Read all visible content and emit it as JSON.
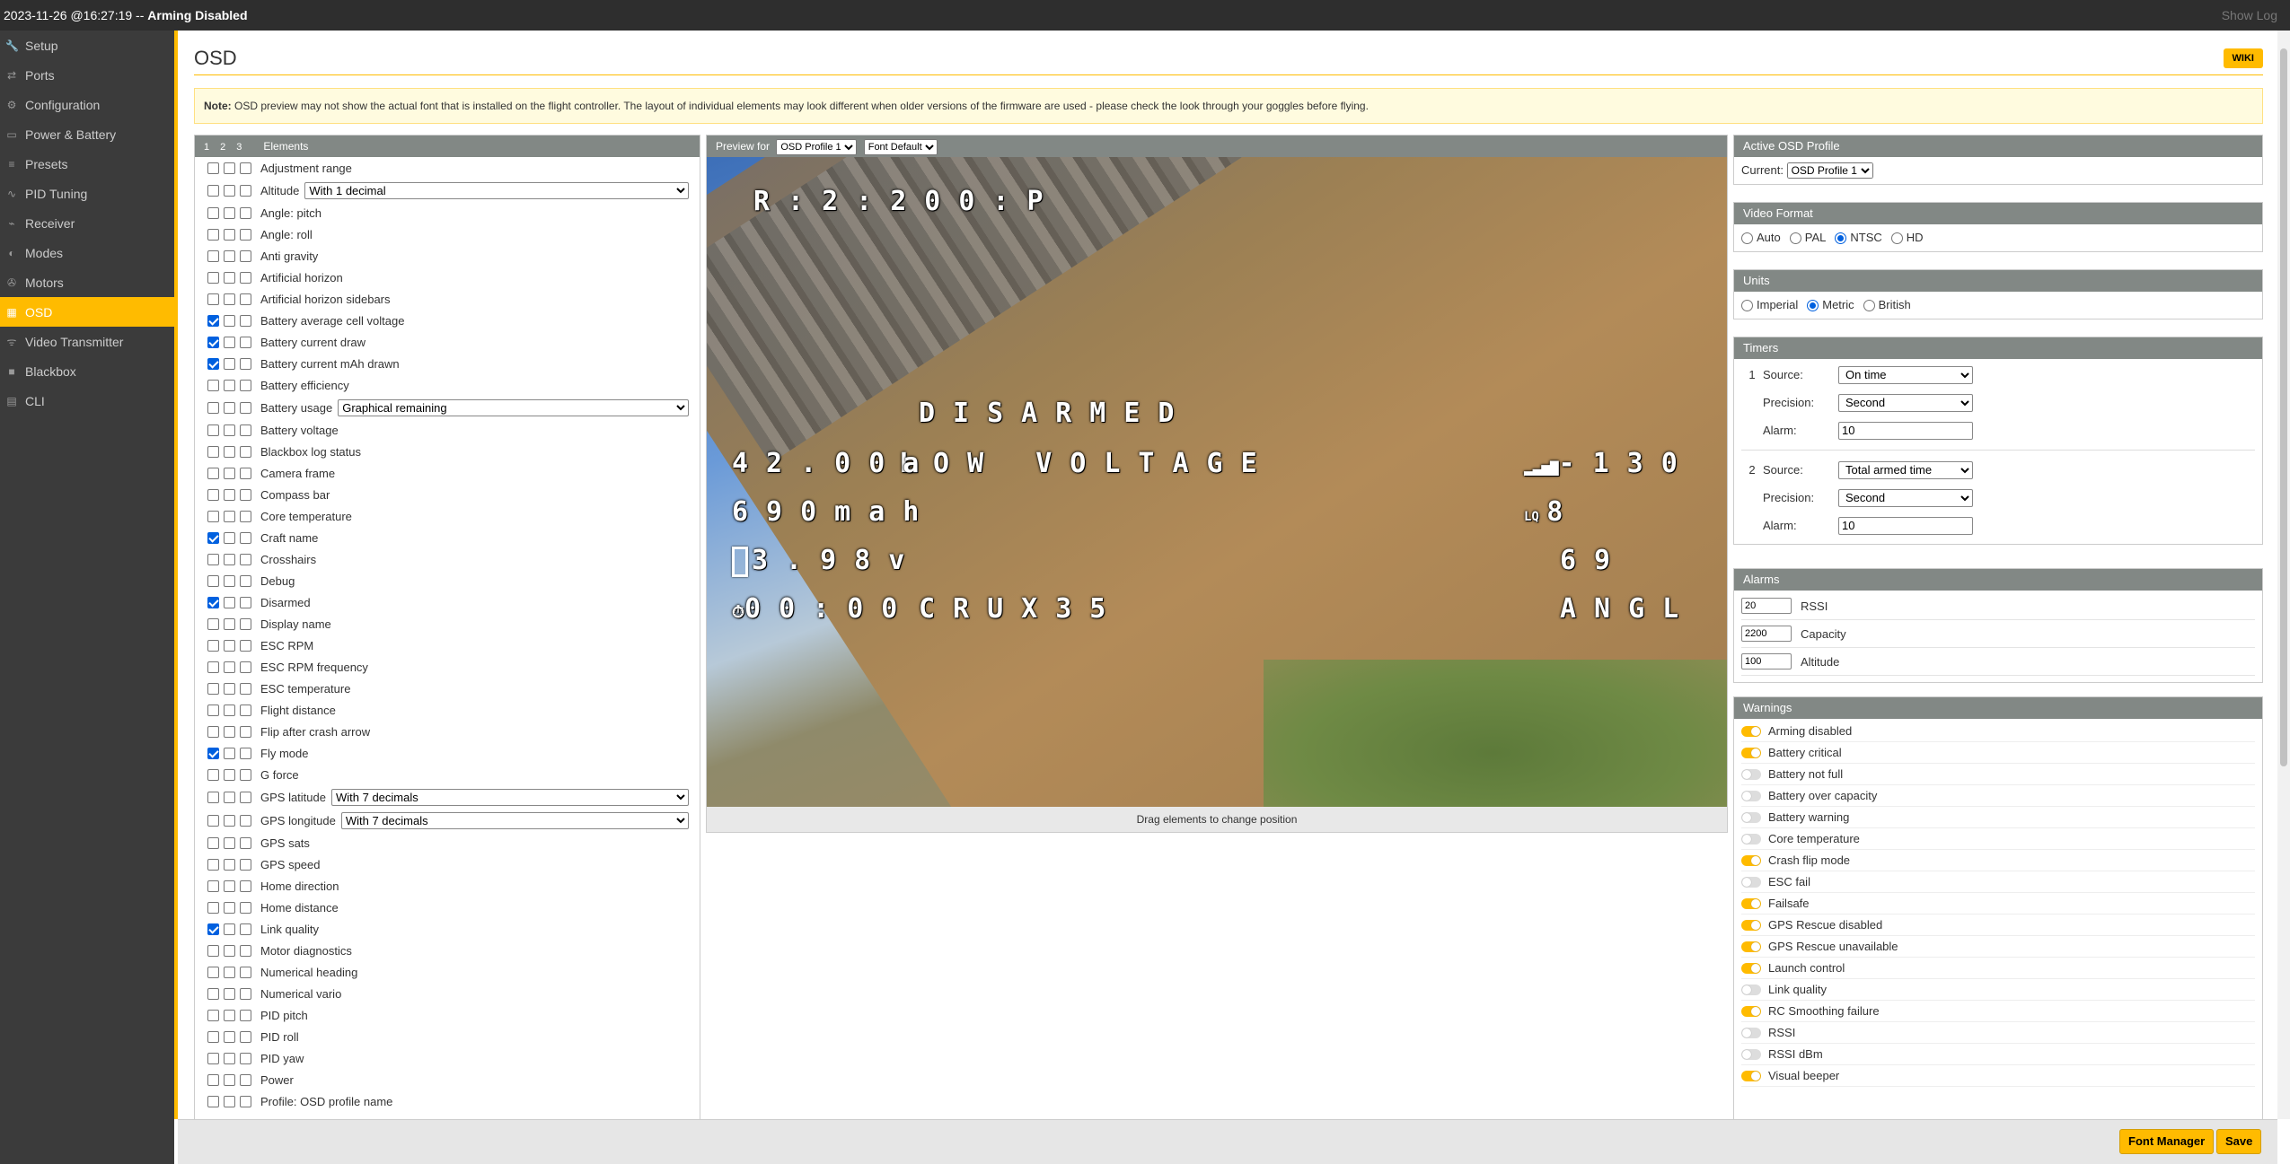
{
  "topbar": {
    "status_prefix": "2023-11-26 @16:27:19 -- ",
    "status_state": "Arming Disabled",
    "show_log": "Show Log"
  },
  "sidebar": {
    "items": [
      {
        "label": "Setup",
        "icon": "wrench-icon"
      },
      {
        "label": "Ports",
        "icon": "plug-icon"
      },
      {
        "label": "Configuration",
        "icon": "gears-icon"
      },
      {
        "label": "Power & Battery",
        "icon": "battery-icon"
      },
      {
        "label": "Presets",
        "icon": "sliders-icon"
      },
      {
        "label": "PID Tuning",
        "icon": "tuning-icon"
      },
      {
        "label": "Receiver",
        "icon": "receiver-icon"
      },
      {
        "label": "Modes",
        "icon": "modes-icon"
      },
      {
        "label": "Motors",
        "icon": "motor-icon"
      },
      {
        "label": "OSD",
        "icon": "osd-icon"
      },
      {
        "label": "Video Transmitter",
        "icon": "antenna-icon"
      },
      {
        "label": "Blackbox",
        "icon": "blackbox-icon"
      },
      {
        "label": "CLI",
        "icon": "terminal-icon"
      }
    ],
    "active_index": 9
  },
  "page": {
    "title": "OSD",
    "wiki": "WIKI",
    "note_bold": "Note:",
    "note_text": " OSD preview may not show the actual font that is installed on the flight controller. The layout of individual elements may look different when older versions of the firmware are used - please check the look through your goggles before flying."
  },
  "elements_panel": {
    "tabs": [
      "1",
      "2",
      "3"
    ],
    "title": "Elements",
    "items": [
      {
        "name": "Adjustment range",
        "checked": [
          false,
          false,
          false
        ]
      },
      {
        "name": "Altitude",
        "checked": [
          false,
          false,
          false
        ],
        "select": "With 1 decimal"
      },
      {
        "name": "Angle: pitch",
        "checked": [
          false,
          false,
          false
        ]
      },
      {
        "name": "Angle: roll",
        "checked": [
          false,
          false,
          false
        ]
      },
      {
        "name": "Anti gravity",
        "checked": [
          false,
          false,
          false
        ]
      },
      {
        "name": "Artificial horizon",
        "checked": [
          false,
          false,
          false
        ]
      },
      {
        "name": "Artificial horizon sidebars",
        "checked": [
          false,
          false,
          false
        ]
      },
      {
        "name": "Battery average cell voltage",
        "checked": [
          true,
          false,
          false
        ]
      },
      {
        "name": "Battery current draw",
        "checked": [
          true,
          false,
          false
        ]
      },
      {
        "name": "Battery current mAh drawn",
        "checked": [
          true,
          false,
          false
        ]
      },
      {
        "name": "Battery efficiency",
        "checked": [
          false,
          false,
          false
        ]
      },
      {
        "name": "Battery usage",
        "checked": [
          false,
          false,
          false
        ],
        "select": "Graphical remaining"
      },
      {
        "name": "Battery voltage",
        "checked": [
          false,
          false,
          false
        ]
      },
      {
        "name": "Blackbox log status",
        "checked": [
          false,
          false,
          false
        ]
      },
      {
        "name": "Camera frame",
        "checked": [
          false,
          false,
          false
        ]
      },
      {
        "name": "Compass bar",
        "checked": [
          false,
          false,
          false
        ]
      },
      {
        "name": "Core temperature",
        "checked": [
          false,
          false,
          false
        ]
      },
      {
        "name": "Craft name",
        "checked": [
          true,
          false,
          false
        ]
      },
      {
        "name": "Crosshairs",
        "checked": [
          false,
          false,
          false
        ]
      },
      {
        "name": "Debug",
        "checked": [
          false,
          false,
          false
        ]
      },
      {
        "name": "Disarmed",
        "checked": [
          true,
          false,
          false
        ]
      },
      {
        "name": "Display name",
        "checked": [
          false,
          false,
          false
        ]
      },
      {
        "name": "ESC RPM",
        "checked": [
          false,
          false,
          false
        ]
      },
      {
        "name": "ESC RPM frequency",
        "checked": [
          false,
          false,
          false
        ]
      },
      {
        "name": "ESC temperature",
        "checked": [
          false,
          false,
          false
        ]
      },
      {
        "name": "Flight distance",
        "checked": [
          false,
          false,
          false
        ]
      },
      {
        "name": "Flip after crash arrow",
        "checked": [
          false,
          false,
          false
        ]
      },
      {
        "name": "Fly mode",
        "checked": [
          true,
          false,
          false
        ]
      },
      {
        "name": "G force",
        "checked": [
          false,
          false,
          false
        ]
      },
      {
        "name": "GPS latitude",
        "checked": [
          false,
          false,
          false
        ],
        "select": "With 7 decimals"
      },
      {
        "name": "GPS longitude",
        "checked": [
          false,
          false,
          false
        ],
        "select": "With 7 decimals"
      },
      {
        "name": "GPS sats",
        "checked": [
          false,
          false,
          false
        ]
      },
      {
        "name": "GPS speed",
        "checked": [
          false,
          false,
          false
        ]
      },
      {
        "name": "Home direction",
        "checked": [
          false,
          false,
          false
        ]
      },
      {
        "name": "Home distance",
        "checked": [
          false,
          false,
          false
        ]
      },
      {
        "name": "Link quality",
        "checked": [
          true,
          false,
          false
        ]
      },
      {
        "name": "Motor diagnostics",
        "checked": [
          false,
          false,
          false
        ]
      },
      {
        "name": "Numerical heading",
        "checked": [
          false,
          false,
          false
        ]
      },
      {
        "name": "Numerical vario",
        "checked": [
          false,
          false,
          false
        ]
      },
      {
        "name": "PID pitch",
        "checked": [
          false,
          false,
          false
        ]
      },
      {
        "name": "PID roll",
        "checked": [
          false,
          false,
          false
        ]
      },
      {
        "name": "PID yaw",
        "checked": [
          false,
          false,
          false
        ]
      },
      {
        "name": "Power",
        "checked": [
          false,
          false,
          false
        ]
      },
      {
        "name": "Profile: OSD profile name",
        "checked": [
          false,
          false,
          false
        ]
      }
    ]
  },
  "preview": {
    "label": "Preview for",
    "profile": "OSD Profile 1",
    "font": "Font Default",
    "drag_note": "Drag elements to change position",
    "osd": {
      "rate": "R:2:200:P",
      "disarmed": "DISARMED",
      "warning": "LOW VOLTAGE",
      "current": "42.00a",
      "mah": "690mah",
      "voltage": "3.98v",
      "timer": "00:00",
      "craft": "CRUX35",
      "rssi": "-130",
      "lq": "8",
      "sats": "69",
      "mode": "ANGL"
    }
  },
  "active_profile": {
    "title": "Active OSD Profile",
    "label": "Current:",
    "value": "OSD Profile 1"
  },
  "video_format": {
    "title": "Video Format",
    "options": [
      "Auto",
      "PAL",
      "NTSC",
      "HD"
    ],
    "selected": 2
  },
  "units": {
    "title": "Units",
    "options": [
      "Imperial",
      "Metric",
      "British"
    ],
    "selected": 1
  },
  "timers": {
    "title": "Timers",
    "items": [
      {
        "num": "1",
        "source_label": "Source:",
        "source": "On time",
        "precision_label": "Precision:",
        "precision": "Second",
        "alarm_label": "Alarm:",
        "alarm": "10"
      },
      {
        "num": "2",
        "source_label": "Source:",
        "source": "Total armed time",
        "precision_label": "Precision:",
        "precision": "Second",
        "alarm_label": "Alarm:",
        "alarm": "10"
      }
    ]
  },
  "alarms": {
    "title": "Alarms",
    "items": [
      {
        "value": "20",
        "label": "RSSI"
      },
      {
        "value": "2200",
        "label": "Capacity"
      },
      {
        "value": "100",
        "label": "Altitude"
      }
    ]
  },
  "warnings": {
    "title": "Warnings",
    "items": [
      {
        "label": "Arming disabled",
        "on": true
      },
      {
        "label": "Battery critical",
        "on": true
      },
      {
        "label": "Battery not full",
        "on": false
      },
      {
        "label": "Battery over capacity",
        "on": false
      },
      {
        "label": "Battery warning",
        "on": false
      },
      {
        "label": "Core temperature",
        "on": false
      },
      {
        "label": "Crash flip mode",
        "on": true
      },
      {
        "label": "ESC fail",
        "on": false
      },
      {
        "label": "Failsafe",
        "on": true
      },
      {
        "label": "GPS Rescue disabled",
        "on": true
      },
      {
        "label": "GPS Rescue unavailable",
        "on": true
      },
      {
        "label": "Launch control",
        "on": true
      },
      {
        "label": "Link quality",
        "on": false
      },
      {
        "label": "RC Smoothing failure",
        "on": true
      },
      {
        "label": "RSSI",
        "on": false
      },
      {
        "label": "RSSI dBm",
        "on": false
      },
      {
        "label": "Visual beeper",
        "on": true
      }
    ]
  },
  "bottom": {
    "font_manager": "Font Manager",
    "save": "Save"
  },
  "colors": {
    "accent": "#ffbb00",
    "sidebar": "#3b3b3b",
    "topbar": "#2e2e2e",
    "panel_header": "#828885"
  }
}
